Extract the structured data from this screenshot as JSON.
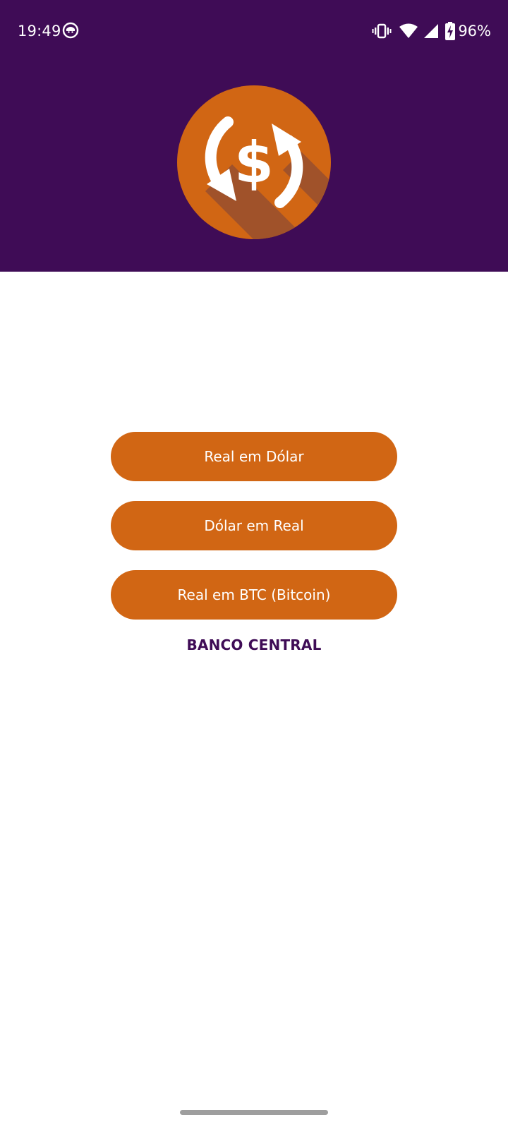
{
  "status_bar": {
    "time": "19:49",
    "battery_percent": "96%",
    "icons": [
      "app-notification-icon",
      "vibrate-icon",
      "wifi-icon",
      "cell-signal-icon",
      "battery-charging-icon"
    ]
  },
  "colors": {
    "primary": "#3f0c56",
    "accent": "#d16614",
    "background": "#ffffff"
  },
  "logo": {
    "icon": "currency-exchange-icon"
  },
  "buttons": {
    "real_to_dollar": "Real em Dólar",
    "dollar_to_real": "Dólar em Real",
    "real_to_btc": "Real em BTC (Bitcoin)"
  },
  "link": {
    "central_bank": "BANCO CENTRAL"
  }
}
